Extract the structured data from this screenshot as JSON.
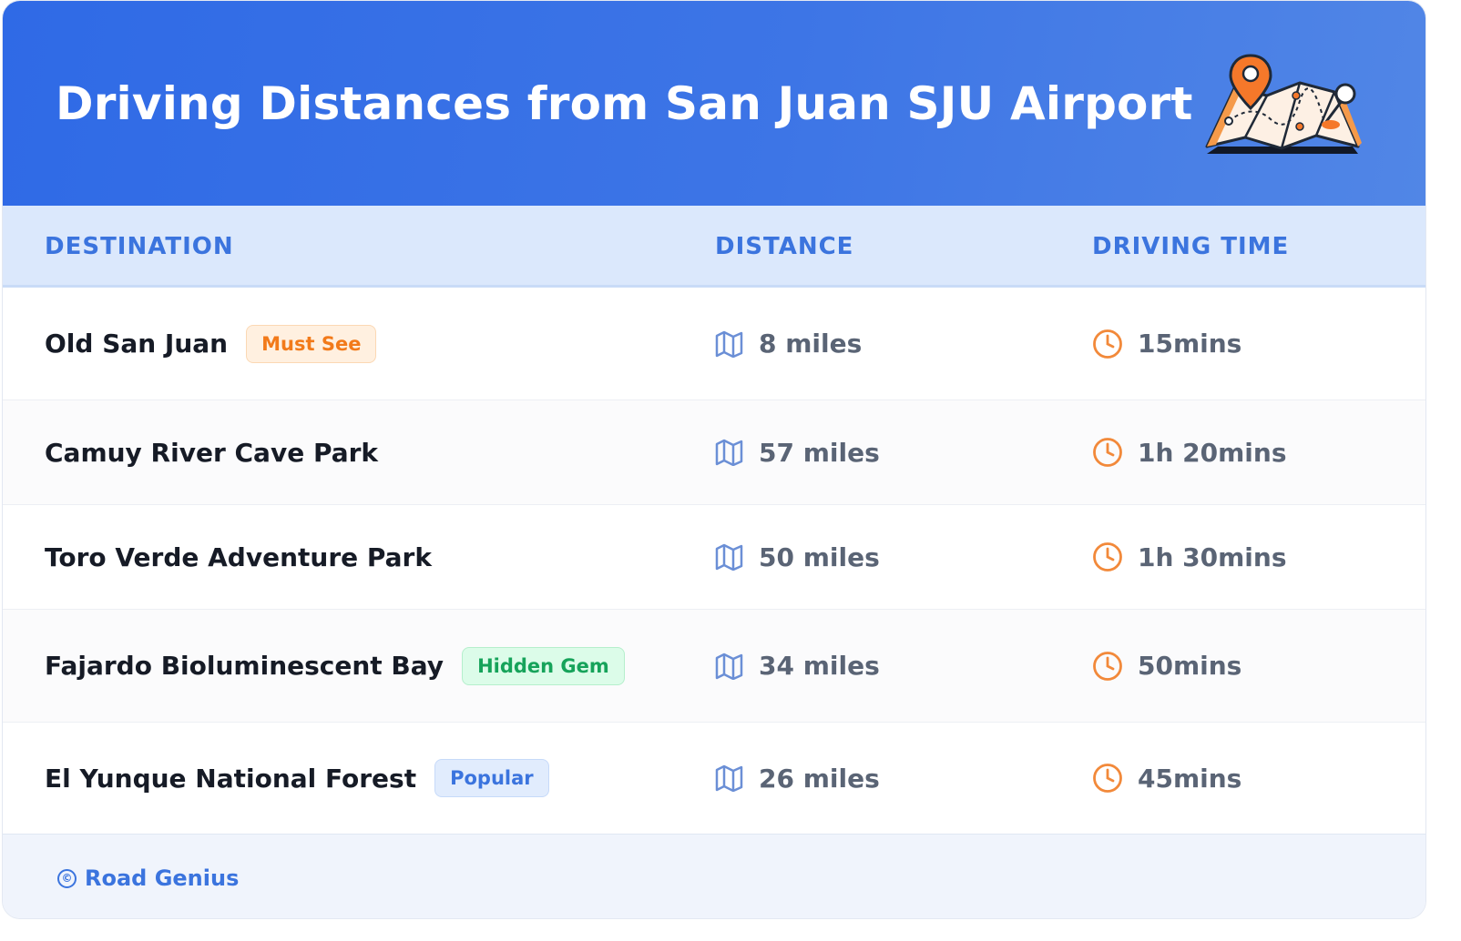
{
  "header": {
    "title": "Driving Distances from San Juan SJU Airport",
    "illustration_icon": "map-pin-illustration"
  },
  "table": {
    "columns": [
      "DESTINATION",
      "DISTANCE",
      "DRIVING TIME"
    ],
    "rows": [
      {
        "destination": "Old San Juan",
        "badge": "Must See",
        "badge_color": "#f27a1a",
        "distance": "8 miles",
        "time": "15mins"
      },
      {
        "destination": "Camuy River Cave Park",
        "badge": "",
        "badge_color": "",
        "distance": "57 miles",
        "time": "1h 20mins"
      },
      {
        "destination": "Toro Verde Adventure Park",
        "badge": "",
        "badge_color": "",
        "distance": "50 miles",
        "time": "1h 30mins"
      },
      {
        "destination": "Fajardo Bioluminescent Bay",
        "badge": "Hidden Gem",
        "badge_color": "#16a35a",
        "distance": "34 miles",
        "time": "50mins"
      },
      {
        "destination": "El Yunque National Forest",
        "badge": "Popular",
        "badge_color": "#3b74de",
        "distance": "26 miles",
        "time": "45mins"
      }
    ],
    "distance_icon": "map-icon",
    "time_icon": "clock-icon"
  },
  "footer": {
    "copyright_symbol": "©",
    "brand": "Road Genius"
  },
  "colors": {
    "header_gradient_start": "#2f6ae6",
    "header_gradient_end": "#5186e6",
    "accent_blue": "#3b74de",
    "accent_orange": "#f27a1a",
    "accent_green": "#16a35a"
  }
}
